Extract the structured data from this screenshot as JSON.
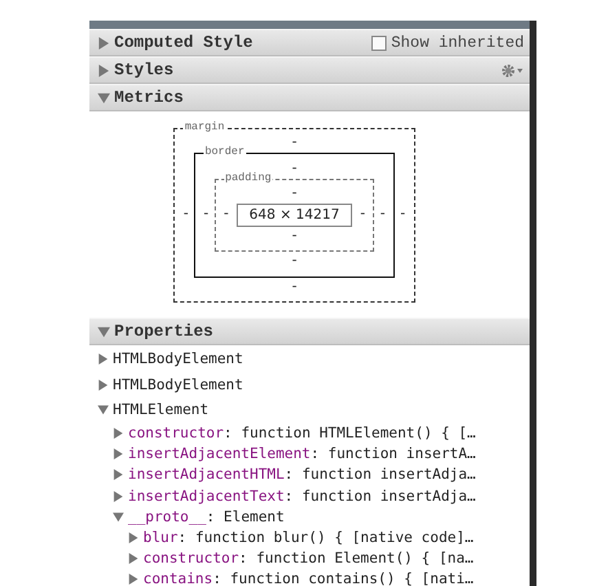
{
  "sections": [
    {
      "kind": "computed",
      "title": "Computed Style",
      "expanded": false,
      "checkbox": {
        "label": "Show inherited",
        "checked": false
      }
    },
    {
      "kind": "styles",
      "title": "Styles",
      "expanded": false
    },
    {
      "kind": "metrics",
      "title": "Metrics",
      "expanded": true
    },
    {
      "kind": "properties",
      "title": "Properties",
      "expanded": true
    }
  ],
  "metrics": {
    "boxes": [
      {
        "kind": "margin",
        "label": "margin",
        "top": "-",
        "left": "-"
      },
      {
        "kind": "border",
        "label": "border",
        "top": "-",
        "left": "-"
      },
      {
        "kind": "padding",
        "label": "padding",
        "top": "-",
        "left": "-"
      }
    ],
    "bottom_values_inner_to_outer": [
      "-",
      "-",
      "-"
    ],
    "content": "648 × 14217",
    "right_values_inner_to_outer": [
      "-",
      "-",
      "-"
    ]
  },
  "properties": [
    {
      "name": "HTMLBodyElement",
      "expanded": false
    },
    {
      "name": "HTMLBodyElement",
      "expanded": false
    },
    {
      "name": "HTMLElement",
      "expanded": true,
      "children": [
        {
          "key": "constructor",
          "value": ": function HTMLElement() { […",
          "expanded": false
        },
        {
          "key": "insertAdjacentElement",
          "value": ": function insertA…",
          "expanded": false
        },
        {
          "key": "insertAdjacentHTML",
          "value": ": function insertAdja…",
          "expanded": false
        },
        {
          "key": "insertAdjacentText",
          "value": ": function insertAdja…",
          "expanded": false
        },
        {
          "key": "__proto__",
          "value": ": Element",
          "expanded": true,
          "children": [
            {
              "key": "blur",
              "value": ": function blur() { [native code]…",
              "expanded": false
            },
            {
              "key": "constructor",
              "value": ": function Element() { [na…",
              "expanded": false
            },
            {
              "key": "contains",
              "value": ": function contains() { [nati…",
              "expanded": false
            }
          ]
        }
      ]
    }
  ]
}
